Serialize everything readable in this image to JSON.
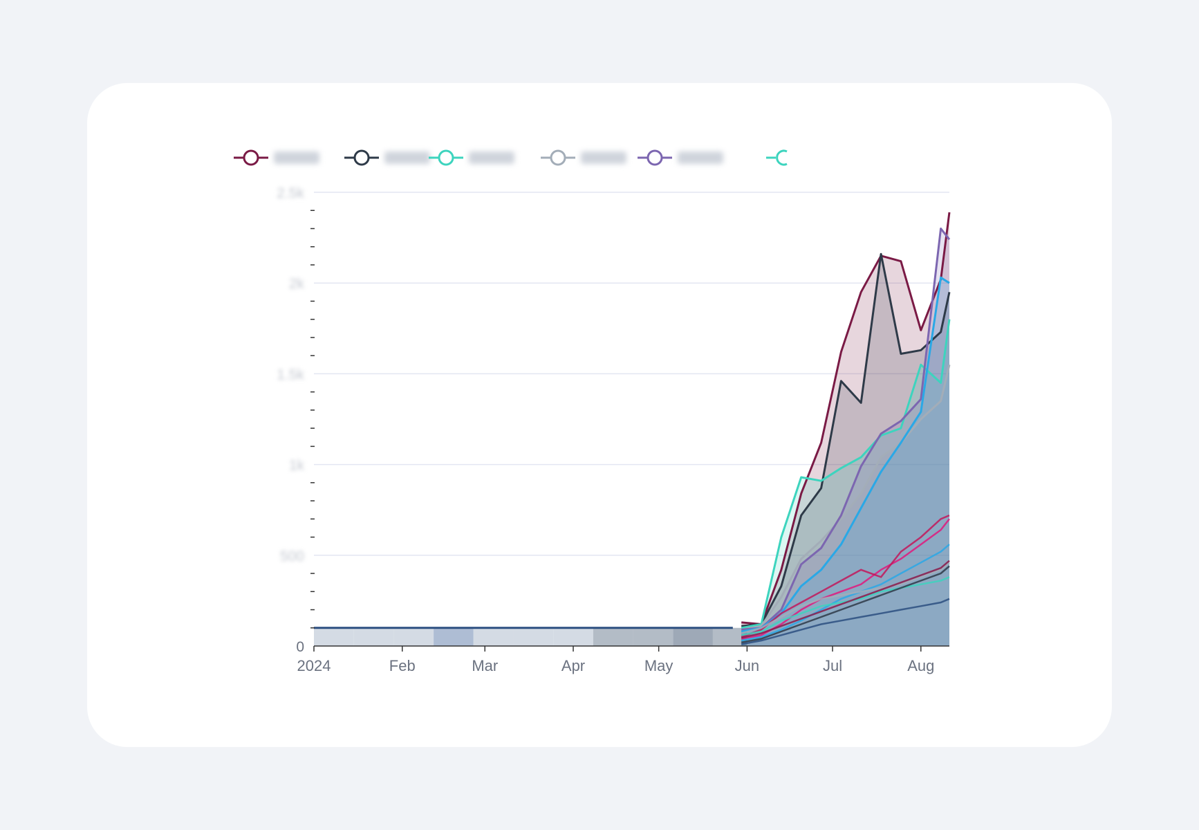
{
  "chart_data": {
    "type": "area",
    "x_ticks": [
      "2024",
      "Feb",
      "Mar",
      "Apr",
      "May",
      "Jun",
      "Jul",
      "Aug"
    ],
    "x_tick_dates": [
      "2024-01-01",
      "2024-02-01",
      "2024-03-01",
      "2024-04-01",
      "2024-05-01",
      "2024-06-01",
      "2024-07-01",
      "2024-08-01"
    ],
    "x_range": [
      "2024-01-01",
      "2024-08-11"
    ],
    "y_ticks": [
      0,
      500,
      1000,
      1500,
      2000,
      2500
    ],
    "y_tick_labels": [
      "0",
      "500",
      "1k",
      "1.5k",
      "2k",
      "2.5k"
    ],
    "ylim": [
      0,
      2500
    ],
    "grid": true,
    "legend_position": "top",
    "dates": [
      "2024-05-30",
      "2024-06-06",
      "2024-06-13",
      "2024-06-20",
      "2024-06-27",
      "2024-07-04",
      "2024-07-11",
      "2024-07-18",
      "2024-07-25",
      "2024-08-01",
      "2024-08-08",
      "2024-08-11"
    ],
    "series": [
      {
        "name": "",
        "color": "#7a1a45",
        "values": [
          130,
          120,
          420,
          840,
          1120,
          1620,
          1950,
          2150,
          2120,
          1740,
          2020,
          2390
        ]
      },
      {
        "name": "",
        "color": "#2e3a48",
        "values": [
          110,
          120,
          330,
          720,
          870,
          1460,
          1340,
          2160,
          1610,
          1630,
          1730,
          1950
        ]
      },
      {
        "name": "",
        "color": "#3dd4be",
        "values": [
          100,
          120,
          600,
          930,
          910,
          980,
          1040,
          1160,
          1200,
          1550,
          1450,
          1800
        ]
      },
      {
        "name": "",
        "color": "#a3adb8",
        "values": [
          90,
          110,
          270,
          480,
          580,
          700,
          840,
          1040,
          1120,
          1250,
          1350,
          1550
        ]
      },
      {
        "name": "",
        "color": "#7c66b0",
        "values": [
          90,
          100,
          200,
          450,
          540,
          720,
          990,
          1170,
          1240,
          1360,
          2300,
          2240
        ]
      },
      {
        "name": "",
        "color": "#2aa8e6",
        "values": [
          80,
          100,
          180,
          330,
          420,
          560,
          760,
          960,
          1120,
          1290,
          2030,
          2000
        ]
      }
    ],
    "legend_extra_color": "#3dd4be"
  }
}
